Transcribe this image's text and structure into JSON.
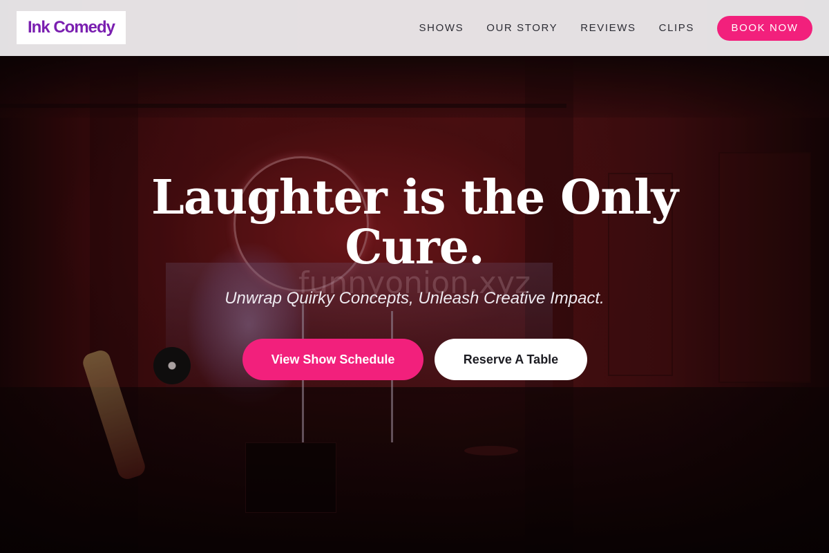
{
  "brand": {
    "logo_text": "Ink Comedy",
    "logo_color": "#7a1fb0",
    "accent_color": "#f2207c"
  },
  "nav": {
    "links": [
      {
        "label": "SHOWS"
      },
      {
        "label": "OUR STORY"
      },
      {
        "label": "REVIEWS"
      },
      {
        "label": "CLIPS"
      }
    ],
    "cta_label": "BOOK NOW"
  },
  "hero": {
    "headline": "Laughter is the Only Cure.",
    "subtitle": "Unwrap Quirky Concepts, Unleash Creative Impact.",
    "primary_button": "View Show Schedule",
    "secondary_button": "Reserve A Table",
    "watermark": "funnyonion.xyz",
    "background_image": "comedy-stage-red-light"
  }
}
